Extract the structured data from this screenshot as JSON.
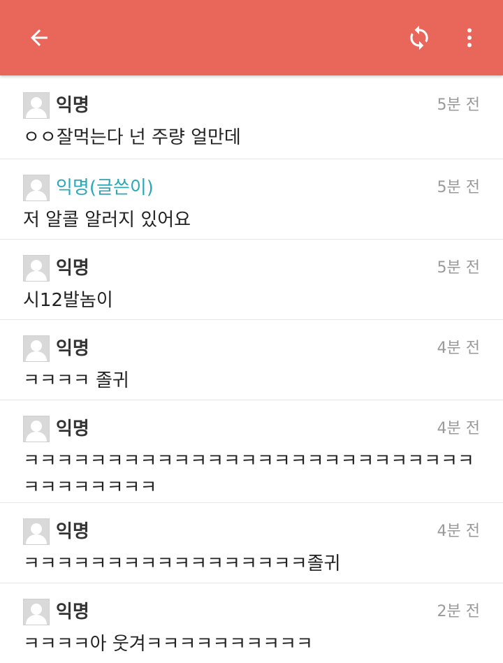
{
  "header": {
    "back_icon": "arrow-left-icon",
    "refresh_icon": "refresh-icon",
    "more_icon": "more-vert-icon",
    "background_color": "#e8675a"
  },
  "comments": [
    {
      "author": "익명",
      "is_op": false,
      "time": "5분 전",
      "text": "ㅇㅇ잘먹는다 넌 주량 얼만데"
    },
    {
      "author": "익명(글쓴이)",
      "is_op": true,
      "time": "5분 전",
      "text": "저 알콜 알러지 있어요"
    },
    {
      "author": "익명",
      "is_op": false,
      "time": "5분 전",
      "text": "시12발놈이"
    },
    {
      "author": "익명",
      "is_op": false,
      "time": "4분 전",
      "text": "ㅋㅋㅋㅋ 졸귀"
    },
    {
      "author": "익명",
      "is_op": false,
      "time": "4분 전",
      "text": "ㅋㅋㅋㅋㅋㅋㅋㅋㅋㅋㅋㅋㅋㅋㅋㅋㅋㅋㅋㅋㅋㅋㅋㅋㅋㅋㅋㅋㅋㅋㅋㅋㅋㅋㅋ"
    },
    {
      "author": "익명",
      "is_op": false,
      "time": "4분 전",
      "text": "ㅋㅋㅋㅋㅋㅋㅋㅋㅋㅋㅋㅋㅋㅋㅋㅋㅋ졸귀"
    },
    {
      "author": "익명",
      "is_op": false,
      "time": "2분 전",
      "text": "ㅋㅋㅋㅋ아 웃겨ㅋㅋㅋㅋㅋㅋㅋㅋㅋㅋ"
    }
  ]
}
